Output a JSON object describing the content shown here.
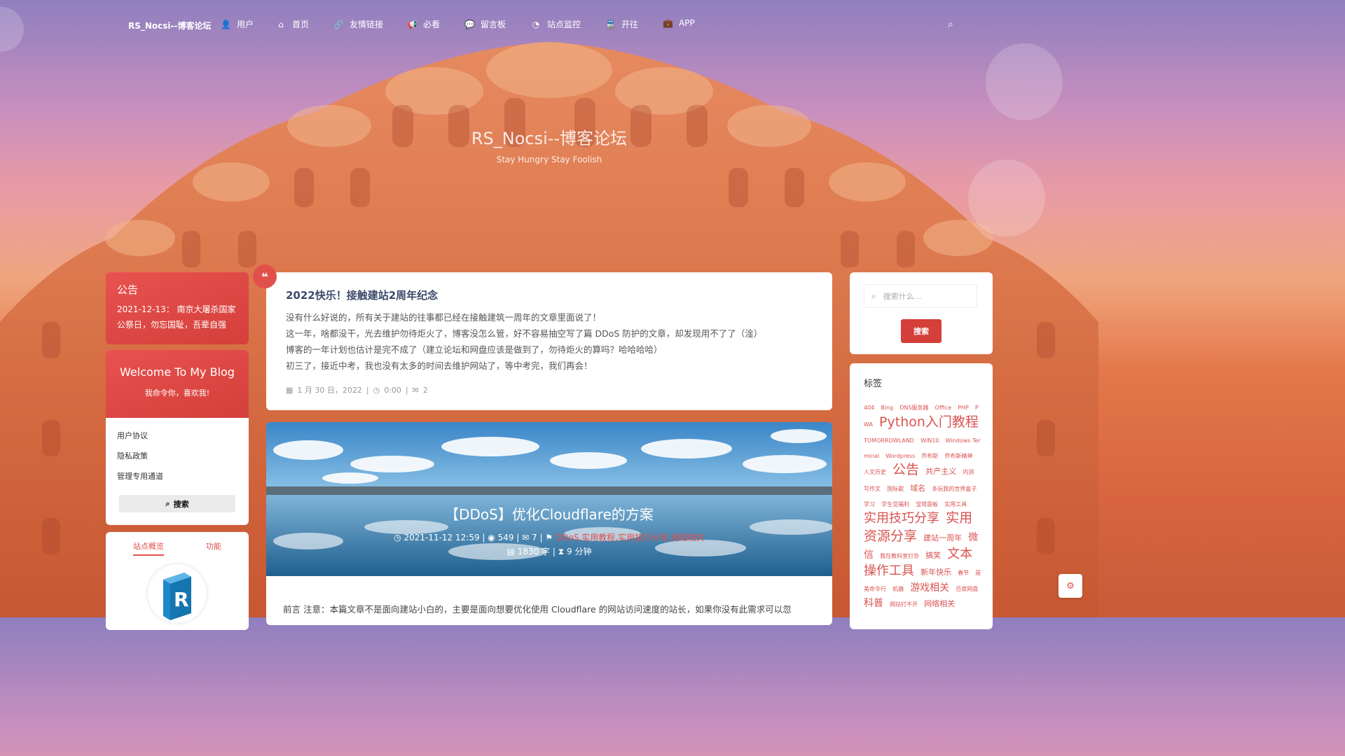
{
  "nav": {
    "brand": "RS_Nocsi--博客论坛",
    "items": [
      {
        "label": "用户",
        "icon": "user-icon",
        "glyph": "👤"
      },
      {
        "label": "首页",
        "icon": "home-icon",
        "glyph": "⌂"
      },
      {
        "label": "友情链接",
        "icon": "link-icon",
        "glyph": "🔗"
      },
      {
        "label": "必看",
        "icon": "megaphone-icon",
        "glyph": "📢"
      },
      {
        "label": "留言板",
        "icon": "comment-icon",
        "glyph": "💬"
      },
      {
        "label": "站点监控",
        "icon": "monitor-icon",
        "glyph": "◔"
      },
      {
        "label": "开往",
        "icon": "train-icon",
        "glyph": "🚆"
      },
      {
        "label": "APP",
        "icon": "briefcase-icon",
        "glyph": "💼"
      }
    ]
  },
  "hero": {
    "title": "RS_Nocsi--博客论坛",
    "subtitle": "Stay Hungry Stay Foolish"
  },
  "notice": {
    "heading": "公告",
    "text": "2021-12-13： 南京大屠杀国家公祭日，勿忘国耻，吾辈自强"
  },
  "welcome": {
    "title": "Welcome To My Blog",
    "subtitle": "我命令你，喜欢我!",
    "links": [
      "用户协议",
      "隐私政策",
      "管理专用通道"
    ],
    "search_label": "搜索"
  },
  "overview": {
    "tabs": [
      "站点概览",
      "功能"
    ]
  },
  "post1": {
    "title": "2022快乐！接触建站2周年纪念",
    "lines": [
      "没有什么好说的，所有关于建站的往事都已经在接触建筑一周年的文章里面说了！",
      "这一年，啥都没干，光去维护勿待炬火了，博客没怎么管，好不容易抽空写了篇 DDoS 防护的文章，却发现用不了了（淦）",
      "博客的一年计划也估计是完不成了（建立论坛和网盘应该是做到了，勿待炬火的算吗？哈哈哈哈）",
      "初三了，接近中考，我也没有太多的时间去维护网站了，等中考完，我们再会！"
    ],
    "date": "1 月 30 日，2022",
    "time": "0:00",
    "comments": "2"
  },
  "post2": {
    "title": "【DDoS】优化Cloudflare的方案",
    "datetime": "2021-11-12 12:59",
    "views": "549",
    "comments": "7",
    "categories": "DDoS,实用教程,实用技巧分享,网络相关",
    "words": "1830 字",
    "read_time": "9 分钟",
    "excerpt": "前言 注意：本篇文章不是面向建站小白的，主要是面向想要优化使用 Cloudflare 的网站访问速度的站长，如果你没有此需求可以忽"
  },
  "sidebar_search": {
    "placeholder": "搜索什么...",
    "button": "搜索"
  },
  "tags": {
    "heading": "标签",
    "items": [
      {
        "t": "404",
        "s": "small"
      },
      {
        "t": "Bing",
        "s": "small"
      },
      {
        "t": "DNS服务器",
        "s": "small"
      },
      {
        "t": "Office",
        "s": "small"
      },
      {
        "t": "PHP",
        "s": "small"
      },
      {
        "t": "PWA",
        "s": "small"
      },
      {
        "t": "Python入门教程",
        "s": "xl"
      },
      {
        "t": "TOMORROWLAND",
        "s": "small"
      },
      {
        "t": "WIN10",
        "s": "small"
      },
      {
        "t": "Windows Terminal",
        "s": "small"
      },
      {
        "t": "Wordpress",
        "s": "small"
      },
      {
        "t": "乔布斯",
        "s": "small"
      },
      {
        "t": "乔布斯精神",
        "s": "small"
      },
      {
        "t": "人文历史",
        "s": "small"
      },
      {
        "t": "公告",
        "s": "xl"
      },
      {
        "t": "共产主义",
        "s": "mid"
      },
      {
        "t": "内测",
        "s": "small"
      },
      {
        "t": "写作文",
        "s": "small"
      },
      {
        "t": "国际歌",
        "s": "small"
      },
      {
        "t": "域名",
        "s": "mid"
      },
      {
        "t": "多玩我的世界盒子",
        "s": "small"
      },
      {
        "t": "学习",
        "s": "small"
      },
      {
        "t": "学生党福利",
        "s": "small"
      },
      {
        "t": "宝塔面板",
        "s": "small"
      },
      {
        "t": "实用工具",
        "s": "small"
      },
      {
        "t": "实用技巧分享",
        "s": "lg"
      },
      {
        "t": "实用资源分享",
        "s": "xl"
      },
      {
        "t": "建站一周年",
        "s": "mid"
      },
      {
        "t": "微信",
        "s": "lg2"
      },
      {
        "t": "我在教科室打杂",
        "s": "small"
      },
      {
        "t": "搞笑",
        "s": "mid"
      },
      {
        "t": "文本操作工具",
        "s": "lg"
      },
      {
        "t": "新年快乐",
        "s": "mid"
      },
      {
        "t": "春节",
        "s": "small"
      },
      {
        "t": "是美命令行",
        "s": "small"
      },
      {
        "t": "机器",
        "s": "small"
      },
      {
        "t": "游戏相关",
        "s": "lg2"
      },
      {
        "t": "百度网盘",
        "s": "small"
      },
      {
        "t": "科普",
        "s": "lg2"
      },
      {
        "t": "网站打不开",
        "s": "small"
      },
      {
        "t": "网络相关",
        "s": "mid"
      }
    ]
  },
  "colors": {
    "accent": "#e2504c",
    "nav_text": "#ffffff",
    "title_text": "#3b4a6b"
  }
}
